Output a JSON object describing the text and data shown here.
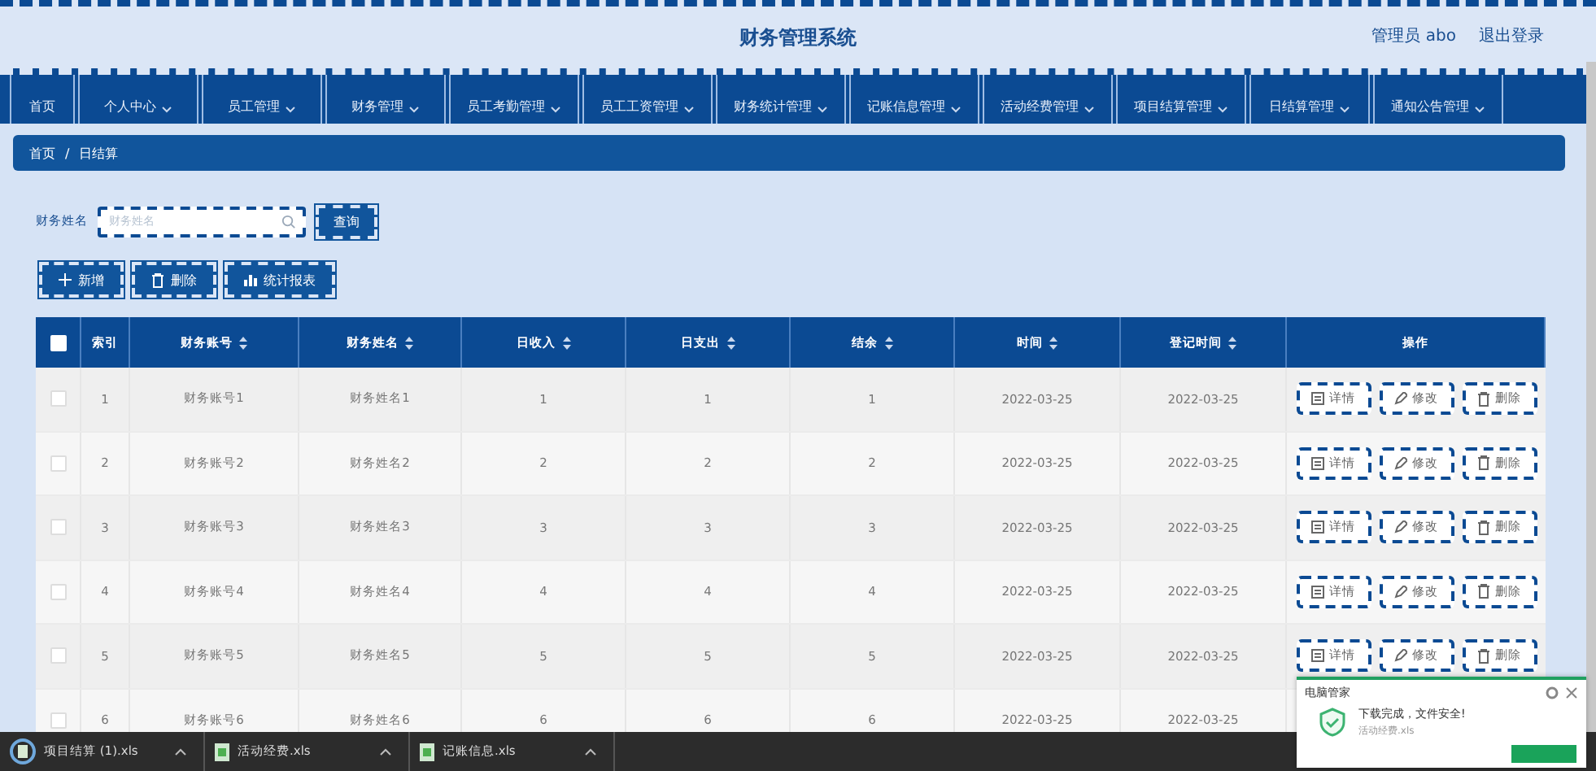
{
  "header": {
    "title": "财务管理系统",
    "user": "管理员 abo",
    "logout": "退出登录"
  },
  "nav": [
    {
      "label": "首页",
      "has_menu": false
    },
    {
      "label": "个人中心",
      "has_menu": true
    },
    {
      "label": "员工管理",
      "has_menu": true
    },
    {
      "label": "财务管理",
      "has_menu": true
    },
    {
      "label": "员工考勤管理",
      "has_menu": true
    },
    {
      "label": "员工工资管理",
      "has_menu": true
    },
    {
      "label": "财务统计管理",
      "has_menu": true
    },
    {
      "label": "记账信息管理",
      "has_menu": true
    },
    {
      "label": "活动经费管理",
      "has_menu": true
    },
    {
      "label": "项目结算管理",
      "has_menu": true
    },
    {
      "label": "日结算管理",
      "has_menu": true
    },
    {
      "label": "通知公告管理",
      "has_menu": true
    }
  ],
  "breadcrumb": {
    "items": [
      "首页",
      "日结算"
    ],
    "separator": "/"
  },
  "search": {
    "label": "财务姓名",
    "placeholder": "财务姓名",
    "button": "查询"
  },
  "toolbar": [
    {
      "kind": "add",
      "label": "新增"
    },
    {
      "kind": "delete",
      "label": "删除"
    },
    {
      "kind": "chart",
      "label": "统计报表"
    }
  ],
  "table": {
    "all_checked": false,
    "columns": [
      {
        "label": "索引",
        "sortable": false
      },
      {
        "label": "财务账号",
        "sortable": true
      },
      {
        "label": "财务姓名",
        "sortable": true
      },
      {
        "label": "日收入",
        "sortable": true
      },
      {
        "label": "日支出",
        "sortable": true
      },
      {
        "label": "结余",
        "sortable": true
      },
      {
        "label": "时间",
        "sortable": true
      },
      {
        "label": "登记时间",
        "sortable": true
      },
      {
        "label": "操作",
        "sortable": false
      }
    ],
    "rows": [
      {
        "checked": false,
        "cells": [
          "1",
          "财务账号1",
          "财务姓名1",
          "1",
          "1",
          "1",
          "2022-03-25",
          "2022-03-25"
        ],
        "actions": [
          {
            "kind": "detail",
            "label": "详情"
          },
          {
            "kind": "edit",
            "label": "修改"
          },
          {
            "kind": "delete",
            "label": "删除"
          }
        ]
      },
      {
        "checked": false,
        "cells": [
          "2",
          "财务账号2",
          "财务姓名2",
          "2",
          "2",
          "2",
          "2022-03-25",
          "2022-03-25"
        ],
        "actions": [
          {
            "kind": "detail",
            "label": "详情"
          },
          {
            "kind": "edit",
            "label": "修改"
          },
          {
            "kind": "delete",
            "label": "删除"
          }
        ]
      },
      {
        "checked": false,
        "cells": [
          "3",
          "财务账号3",
          "财务姓名3",
          "3",
          "3",
          "3",
          "2022-03-25",
          "2022-03-25"
        ],
        "actions": [
          {
            "kind": "detail",
            "label": "详情"
          },
          {
            "kind": "edit",
            "label": "修改"
          },
          {
            "kind": "delete",
            "label": "删除"
          }
        ]
      },
      {
        "checked": false,
        "cells": [
          "4",
          "财务账号4",
          "财务姓名4",
          "4",
          "4",
          "4",
          "2022-03-25",
          "2022-03-25"
        ],
        "actions": [
          {
            "kind": "detail",
            "label": "详情"
          },
          {
            "kind": "edit",
            "label": "修改"
          },
          {
            "kind": "delete",
            "label": "删除"
          }
        ]
      },
      {
        "checked": false,
        "cells": [
          "5",
          "财务账号5",
          "财务姓名5",
          "5",
          "5",
          "5",
          "2022-03-25",
          "2022-03-25"
        ],
        "actions": [
          {
            "kind": "detail",
            "label": "详情"
          },
          {
            "kind": "edit",
            "label": "修改"
          },
          {
            "kind": "delete",
            "label": "删除"
          }
        ]
      },
      {
        "checked": false,
        "cells": [
          "6",
          "财务账号6",
          "财务姓名6",
          "6",
          "6",
          "6",
          "2022-03-25",
          "2022-03-25"
        ]
      }
    ]
  },
  "downloads": [
    {
      "name": "项目结算 (1).xls",
      "active": true
    },
    {
      "name": "活动经费.xls",
      "active": false
    },
    {
      "name": "记账信息.xls",
      "active": false
    }
  ],
  "notification": {
    "title": "电脑管家",
    "message": "下载完成，文件安全!",
    "file": "活动经费.xls"
  }
}
